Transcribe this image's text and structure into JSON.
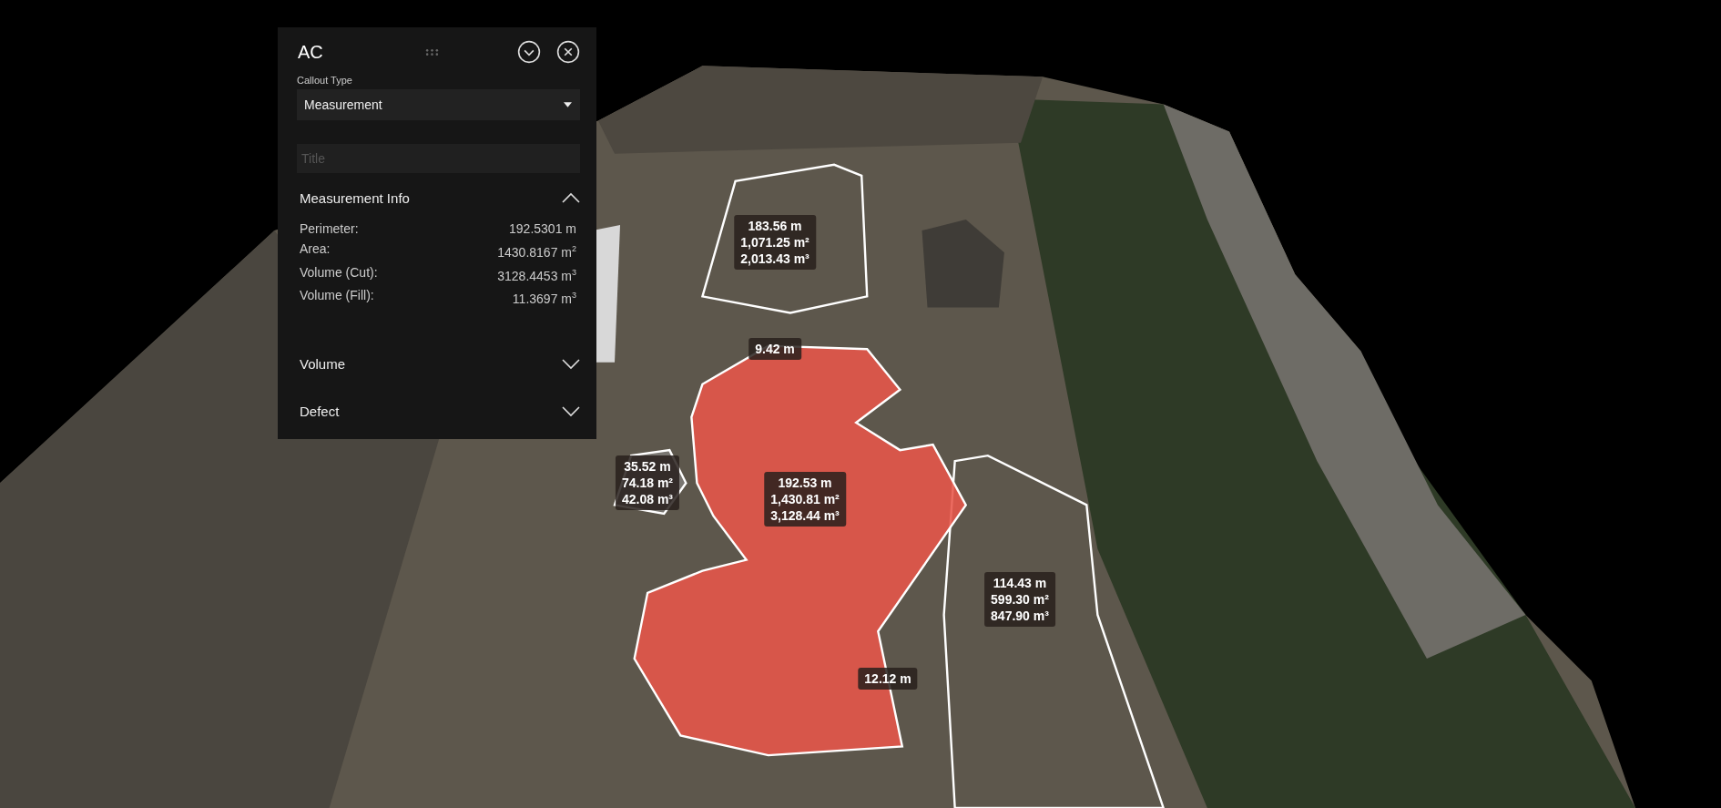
{
  "panel": {
    "title": "AC",
    "callout_type": {
      "label": "Callout Type",
      "value": "Measurement"
    },
    "title_field": {
      "placeholder": "Title"
    },
    "sections": [
      {
        "title": "Measurement Info",
        "expanded": true,
        "rows": [
          {
            "label": "Perimeter:",
            "value": "192.5301 m"
          },
          {
            "label": "Area:",
            "value": "1430.8167 m$^{2}$"
          },
          {
            "label": "Volume (Cut):",
            "value": "3128.4453 m$^{3}$"
          },
          {
            "label": "Volume (Fill):",
            "value": "11.3697 m$^{3}$"
          }
        ]
      },
      {
        "title": "Volume",
        "expanded": false
      },
      {
        "title": "Defect",
        "expanded": false
      }
    ]
  },
  "map_labels": [
    {
      "lines": [
        "183.56 m",
        "1,071.25 m²",
        "2,013.43 m³"
      ]
    },
    {
      "lines": [
        "9.42 m"
      ]
    },
    {
      "lines": [
        "35.52 m",
        "74.18 m²",
        "42.08 m³"
      ]
    },
    {
      "lines": [
        "192.53 m",
        "1,430.81 m²",
        "3,128.44 m³"
      ]
    },
    {
      "lines": [
        "114.43 m",
        "599.30 m²",
        "847.90 m³"
      ]
    },
    {
      "lines": [
        "12.12 m"
      ]
    }
  ]
}
